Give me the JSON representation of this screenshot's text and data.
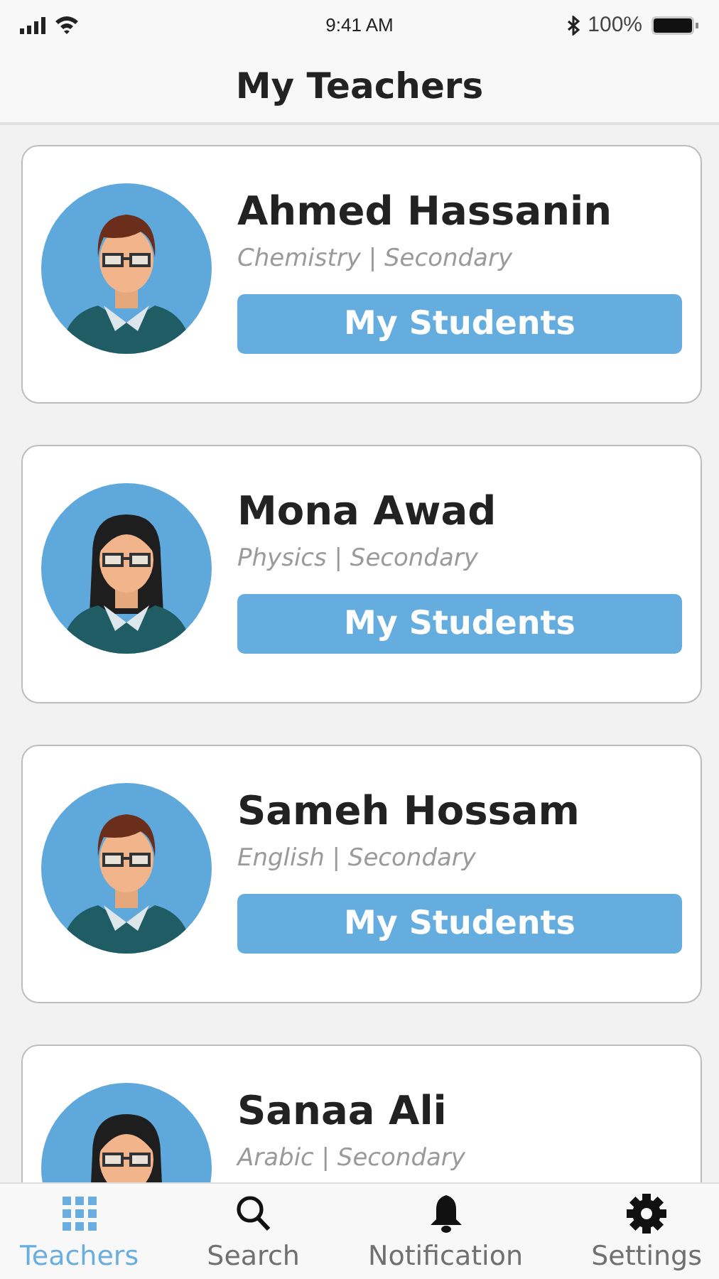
{
  "status_bar": {
    "time": "9:41 AM",
    "battery": "100%"
  },
  "header": {
    "title": "My Teachers"
  },
  "teachers": [
    {
      "name": "Ahmed Hassanin",
      "subject": "Chemistry | Secondary",
      "kind": "short-hair",
      "button": "My Students"
    },
    {
      "name": "Mona Awad",
      "subject": "Physics | Secondary",
      "kind": "long-hair",
      "button": "My Students"
    },
    {
      "name": "Sameh Hossam",
      "subject": "English | Secondary",
      "kind": "short-hair",
      "button": "My Students"
    },
    {
      "name": "Sanaa Ali",
      "subject": "Arabic | Secondary",
      "kind": "long-hair"
    }
  ],
  "tab_bar": [
    {
      "label": "Teachers",
      "selected": true
    },
    {
      "label": "Search",
      "selected": false
    },
    {
      "label": "Notification",
      "selected": false
    },
    {
      "label": "Settings",
      "selected": false
    }
  ]
}
